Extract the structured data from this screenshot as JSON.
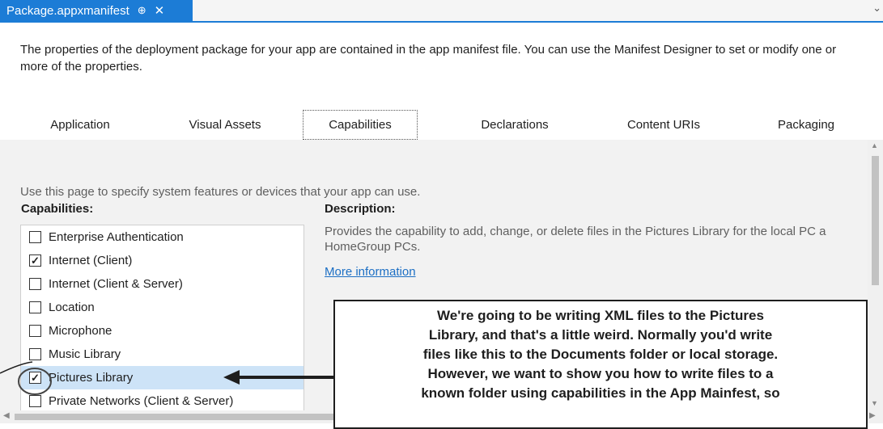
{
  "tab": {
    "title": "Package.appxmanifest",
    "pin": "⊕",
    "close": "✕",
    "overflow": "⌄"
  },
  "intro": "The properties of the deployment package for your app are contained in the app manifest file. You can use the Manifest Designer to set or modify one or more of the properties.",
  "tabs": [
    {
      "label": "Application"
    },
    {
      "label": "Visual Assets"
    },
    {
      "label": "Capabilities",
      "active": true
    },
    {
      "label": "Declarations"
    },
    {
      "label": "Content URIs"
    },
    {
      "label": "Packaging"
    }
  ],
  "page_description": "Use this page to specify system features or devices that your app can use.",
  "capabilities_heading": "Capabilities:",
  "capabilities": [
    {
      "label": "Enterprise Authentication",
      "checked": false
    },
    {
      "label": "Internet (Client)",
      "checked": true
    },
    {
      "label": "Internet (Client & Server)",
      "checked": false
    },
    {
      "label": "Location",
      "checked": false
    },
    {
      "label": "Microphone",
      "checked": false
    },
    {
      "label": "Music Library",
      "checked": false
    },
    {
      "label": "Pictures Library",
      "checked": true,
      "selected": true
    },
    {
      "label": "Private Networks (Client & Server)",
      "checked": false
    }
  ],
  "description_heading": "Description:",
  "description_line1": "Provides the capability to add, change, or delete files in the Pictures Library for the local PC a",
  "description_line2": "HomeGroup PCs.",
  "more_information": "More information",
  "callout": [
    "We're going to be writing XML files to the Pictures",
    "Library, and that's a little weird. Normally you'd write",
    "files like this to the Documents folder or local storage.",
    "However, we want to show you how to write files to a",
    "known folder using capabilities in the App Mainfest, so"
  ],
  "check_glyph": "✓"
}
